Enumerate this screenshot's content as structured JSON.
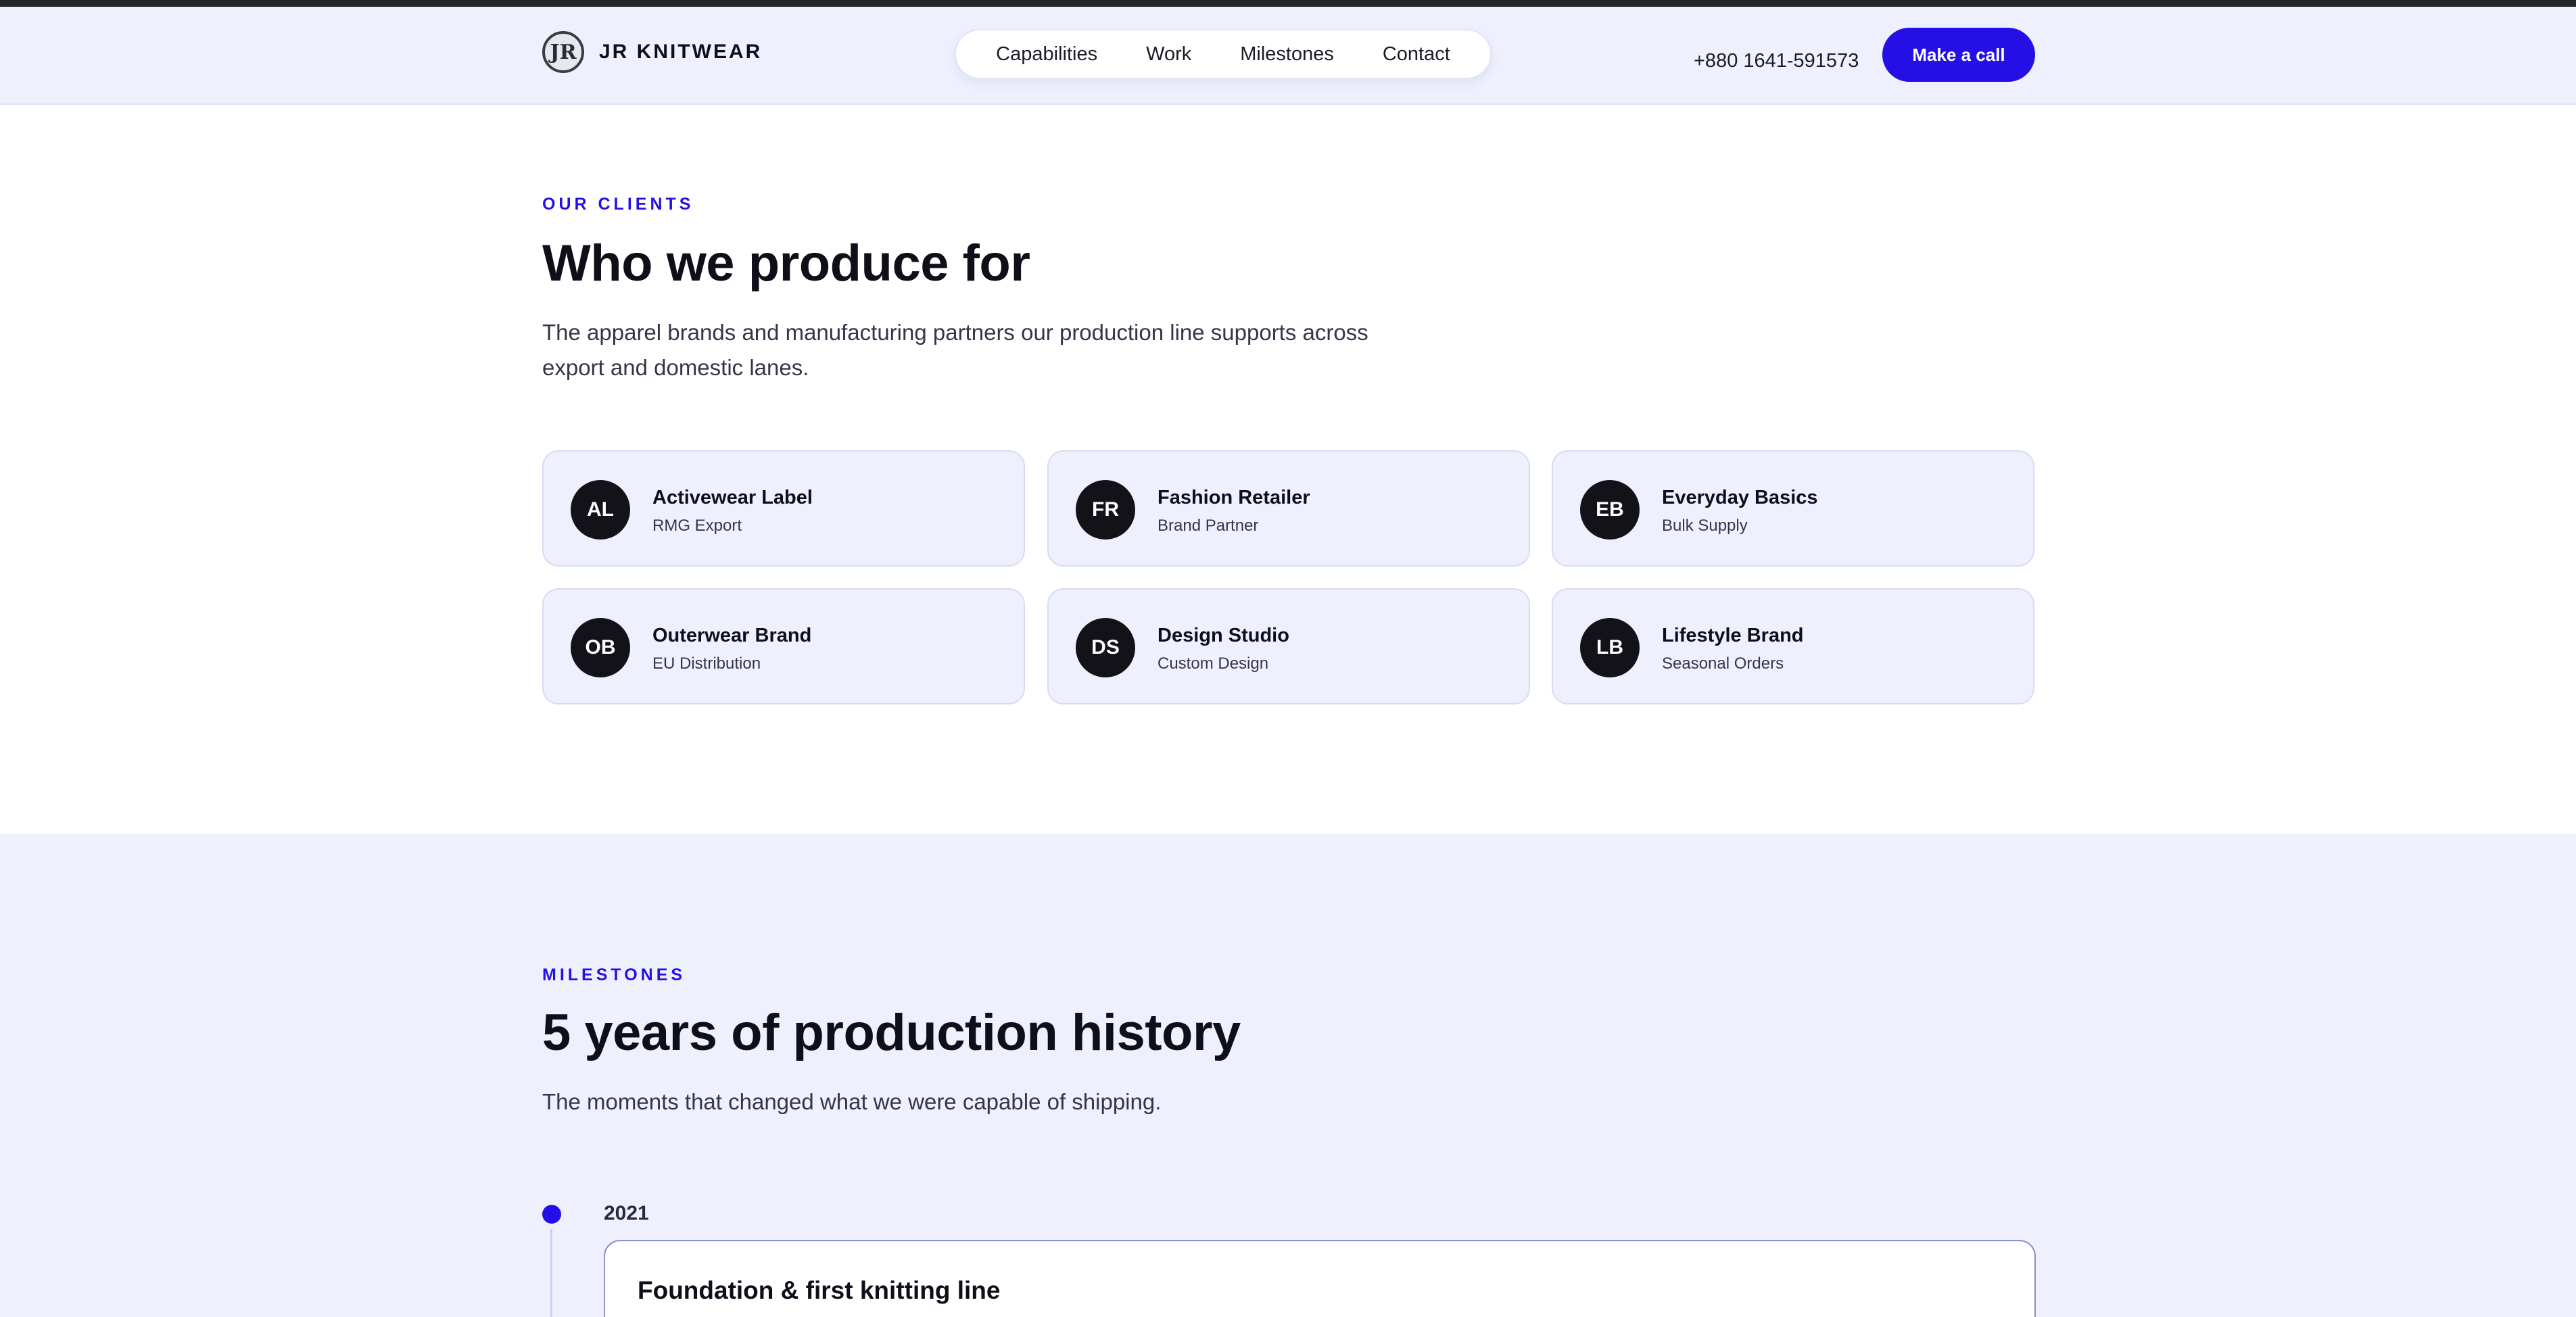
{
  "header": {
    "brand_initials": "JR",
    "brand_name": "JR KNITWEAR",
    "nav": [
      "Capabilities",
      "Work",
      "Milestones",
      "Contact"
    ],
    "phone": "+880 1641-591573",
    "cta_label": "Make a call"
  },
  "clients": {
    "eyebrow": "OUR CLIENTS",
    "title": "Who we produce for",
    "lead": "The apparel brands and manufacturing partners our production line supports across export and domestic lanes.",
    "items": [
      {
        "initials": "AL",
        "name": "Activewear Label",
        "sub": "RMG Export"
      },
      {
        "initials": "FR",
        "name": "Fashion Retailer",
        "sub": "Brand Partner"
      },
      {
        "initials": "EB",
        "name": "Everyday Basics",
        "sub": "Bulk Supply"
      },
      {
        "initials": "OB",
        "name": "Outerwear Brand",
        "sub": "EU Distribution"
      },
      {
        "initials": "DS",
        "name": "Design Studio",
        "sub": "Custom Design"
      },
      {
        "initials": "LB",
        "name": "Lifestyle Brand",
        "sub": "Seasonal Orders"
      }
    ]
  },
  "milestones": {
    "eyebrow": "MILESTONES",
    "title": "5 years of production history",
    "lead": "The moments that changed what we were capable of shipping.",
    "items": [
      {
        "year": "2021",
        "title": "Foundation & first knitting line"
      }
    ]
  },
  "colors": {
    "accent": "#2410e6",
    "section_bg": "#eef1fd",
    "avatar_bg": "#121218"
  }
}
